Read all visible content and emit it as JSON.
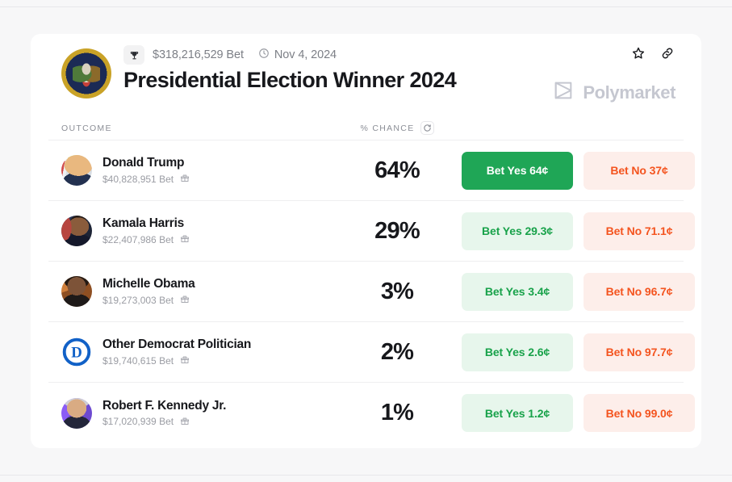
{
  "header": {
    "seal_icon": "presidential-seal",
    "trophy_icon": "trophy-icon",
    "volume": "$318,216,529 Bet",
    "clock_icon": "clock-icon",
    "date": "Nov 4, 2024",
    "title": "Presidential Election Winner 2024",
    "star_icon": "star-icon",
    "link_icon": "link-icon",
    "brand": "Polymarket",
    "brand_logo_icon": "polymarket-logo-icon"
  },
  "table": {
    "col_outcome": "OUTCOME",
    "col_chance": "% CHANCE",
    "refresh_icon": "refresh-icon",
    "rows": [
      {
        "name": "Donald Trump",
        "bet": "$40,828,951 Bet",
        "gift_icon": "gift-icon",
        "chance": "64%",
        "yes_label": "Bet Yes 64¢",
        "no_label": "Bet No 37¢",
        "avatar": "trump"
      },
      {
        "name": "Kamala Harris",
        "bet": "$22,407,986 Bet",
        "gift_icon": "gift-icon",
        "chance": "29%",
        "yes_label": "Bet Yes 29.3¢",
        "no_label": "Bet No 71.1¢",
        "avatar": "harris"
      },
      {
        "name": "Michelle Obama",
        "bet": "$19,273,003 Bet",
        "gift_icon": "gift-icon",
        "chance": "3%",
        "yes_label": "Bet Yes 3.4¢",
        "no_label": "Bet No 96.7¢",
        "avatar": "obama"
      },
      {
        "name": "Other Democrat Politician",
        "bet": "$19,740,615 Bet",
        "gift_icon": "gift-icon",
        "chance": "2%",
        "yes_label": "Bet Yes 2.6¢",
        "no_label": "Bet No 97.7¢",
        "avatar": "dem"
      },
      {
        "name": "Robert F. Kennedy Jr.",
        "bet": "$17,020,939 Bet",
        "gift_icon": "gift-icon",
        "chance": "1%",
        "yes_label": "Bet Yes 1.2¢",
        "no_label": "Bet No 99.0¢",
        "avatar": "rfk"
      }
    ]
  },
  "colors": {
    "yes_active_bg": "#1fa656",
    "yes_bg": "#e7f6ec",
    "yes_text": "#18a24a",
    "no_bg": "#fdeeea",
    "no_text": "#f4541f",
    "page_bg": "#f7f7f8",
    "card_bg": "#ffffff"
  }
}
